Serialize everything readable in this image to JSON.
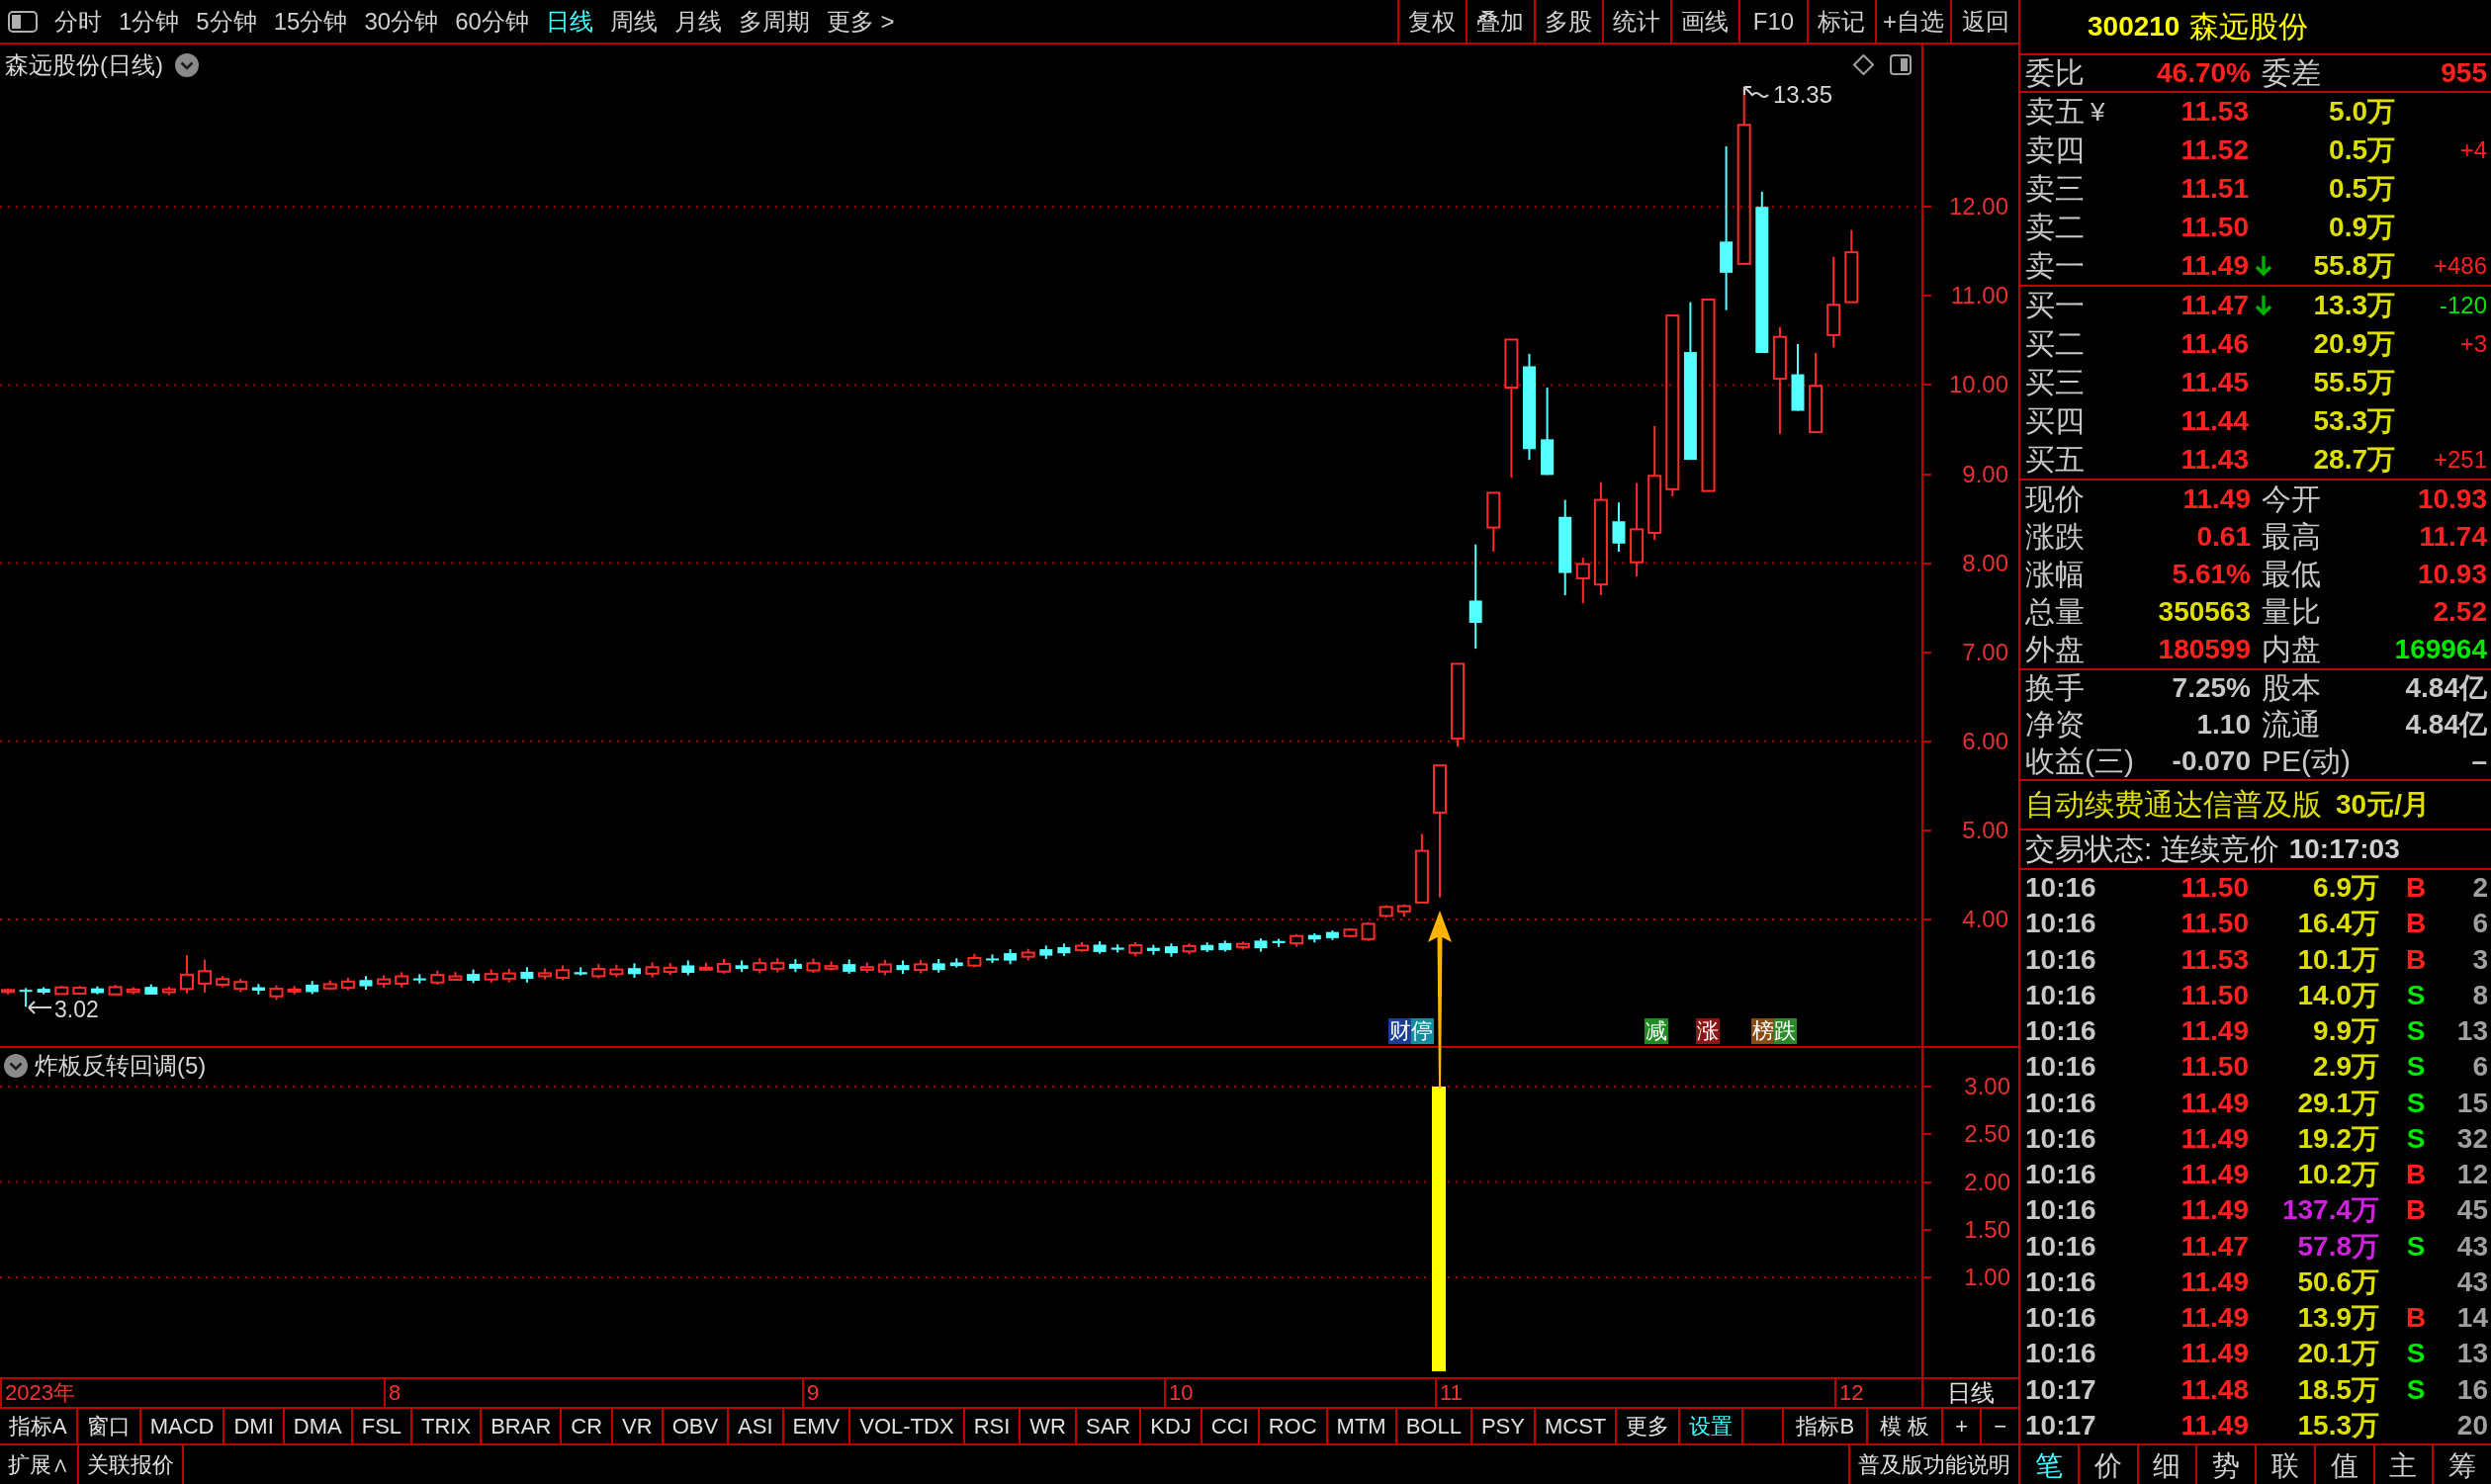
{
  "toolbar": {
    "periods": [
      {
        "label": "分时",
        "selected": false
      },
      {
        "label": "1分钟",
        "selected": false
      },
      {
        "label": "5分钟",
        "selected": false
      },
      {
        "label": "15分钟",
        "selected": false
      },
      {
        "label": "30分钟",
        "selected": false
      },
      {
        "label": "60分钟",
        "selected": false
      },
      {
        "label": "日线",
        "selected": true
      },
      {
        "label": "周线",
        "selected": false
      },
      {
        "label": "月线",
        "selected": false
      },
      {
        "label": "多周期",
        "selected": false
      },
      {
        "label": "更多 >",
        "selected": false
      }
    ],
    "actions": [
      "复权",
      "叠加",
      "多股",
      "统计",
      "画线",
      "F10",
      "标记",
      "+自选",
      "返回"
    ]
  },
  "chart": {
    "title": "森远股份(日线)",
    "price_ticks": [
      "12.00",
      "11.00",
      "10.00",
      "9.00",
      "8.00",
      "7.00",
      "6.00",
      "5.00",
      "4.00"
    ],
    "high_label": "13.35",
    "low_label": "3.02",
    "signals": [
      {
        "text": "财停",
        "kind": "finance"
      },
      {
        "text": "减",
        "kind": "reduce"
      },
      {
        "text": "涨",
        "kind": "rise"
      },
      {
        "text": "榜跌",
        "kind": "ranking"
      }
    ]
  },
  "indicator": {
    "title": "炸板反转回调(5)",
    "ticks": [
      "3.00",
      "2.50",
      "2.00",
      "1.50",
      "1.00"
    ]
  },
  "date_axis": {
    "months": [
      "2023年",
      "8",
      "9",
      "10",
      "11",
      "12"
    ],
    "period": "日线"
  },
  "indicator_tabs": [
    {
      "label": "指标A",
      "highlighted": false
    },
    {
      "label": "窗口",
      "highlighted": false
    },
    {
      "label": "MACD",
      "highlighted": false
    },
    {
      "label": "DMI",
      "highlighted": false
    },
    {
      "label": "DMA",
      "highlighted": false
    },
    {
      "label": "FSL",
      "highlighted": false
    },
    {
      "label": "TRIX",
      "highlighted": false
    },
    {
      "label": "BRAR",
      "highlighted": false
    },
    {
      "label": "CR",
      "highlighted": false
    },
    {
      "label": "VR",
      "highlighted": false
    },
    {
      "label": "OBV",
      "highlighted": false
    },
    {
      "label": "ASI",
      "highlighted": false
    },
    {
      "label": "EMV",
      "highlighted": false
    },
    {
      "label": "VOL-TDX",
      "highlighted": false
    },
    {
      "label": "RSI",
      "highlighted": false
    },
    {
      "label": "WR",
      "highlighted": false
    },
    {
      "label": "SAR",
      "highlighted": false
    },
    {
      "label": "KDJ",
      "highlighted": false
    },
    {
      "label": "CCI",
      "highlighted": false
    },
    {
      "label": "ROC",
      "highlighted": false
    },
    {
      "label": "MTM",
      "highlighted": false
    },
    {
      "label": "BOLL",
      "highlighted": false
    },
    {
      "label": "PSY",
      "highlighted": false
    },
    {
      "label": "MCST",
      "highlighted": false
    },
    {
      "label": "更多",
      "highlighted": false
    },
    {
      "label": "设置",
      "highlighted": true
    }
  ],
  "indicator_tools": [
    "指标B",
    "模 板",
    "+",
    "−"
  ],
  "bottom_bar": {
    "items": [
      "扩展∧",
      "关联报价"
    ],
    "help": "普及版功能说明"
  },
  "quote": {
    "code": "300210",
    "name": "森远股份",
    "ratio": [
      {
        "label": "委比",
        "value": "46.70%",
        "color": "#ff2020"
      },
      {
        "label": "委差",
        "value": "955",
        "color": "#ff2020"
      }
    ],
    "asks": [
      {
        "label": "卖五",
        "symbol": "¥",
        "price": "11.53",
        "price_falling": false,
        "volume": "5.0万"
      },
      {
        "label": "卖四",
        "price": "11.52",
        "price_falling": false,
        "volume": "0.5万",
        "change": {
          "text": "+4",
          "color": "#ff2020"
        }
      },
      {
        "label": "卖三",
        "price": "11.51",
        "price_falling": false,
        "volume": "0.5万"
      },
      {
        "label": "卖二",
        "price": "11.50",
        "price_falling": false,
        "volume": "0.9万"
      },
      {
        "label": "卖一",
        "price": "11.49",
        "price_falling": true,
        "volume": "55.8万",
        "change": {
          "text": "+486",
          "color": "#ff2020"
        }
      }
    ],
    "bids": [
      {
        "label": "买一",
        "price": "11.47",
        "price_falling": true,
        "volume": "13.3万",
        "change": {
          "text": "-120",
          "color": "#00e800"
        }
      },
      {
        "label": "买二",
        "price": "11.46",
        "price_falling": false,
        "volume": "20.9万",
        "change": {
          "text": "+3",
          "color": "#ff2020"
        }
      },
      {
        "label": "买三",
        "price": "11.45",
        "price_falling": false,
        "volume": "55.5万"
      },
      {
        "label": "买四",
        "price": "11.44",
        "price_falling": false,
        "volume": "53.3万"
      },
      {
        "label": "买五",
        "price": "11.43",
        "price_falling": false,
        "volume": "28.7万",
        "change": {
          "text": "+251",
          "color": "#ff2020"
        }
      }
    ],
    "stats": [
      {
        "label": "现价",
        "value": "11.49",
        "color": "#ff2020"
      },
      {
        "label": "今开",
        "value": "10.93",
        "color": "#ff2020"
      },
      {
        "label": "涨跌",
        "value": "0.61",
        "color": "#ff2020"
      },
      {
        "label": "最高",
        "value": "11.74",
        "color": "#ff2020"
      },
      {
        "label": "涨幅",
        "value": "5.61%",
        "color": "#ff2020"
      },
      {
        "label": "最低",
        "value": "10.93",
        "color": "#ff2020"
      },
      {
        "label": "总量",
        "value": "350563",
        "color": "#dede00"
      },
      {
        "label": "量比",
        "value": "2.52",
        "color": "#ff2020"
      },
      {
        "label": "外盘",
        "value": "180599",
        "color": "#ff2020"
      },
      {
        "label": "内盘",
        "value": "169964",
        "color": "#00e800"
      }
    ],
    "fundamentals": [
      {
        "label": "换手",
        "value": "7.25%"
      },
      {
        "label": "股本",
        "value": "4.84亿"
      },
      {
        "label": "净资",
        "value": "1.10"
      },
      {
        "label": "流通",
        "value": "4.84亿"
      },
      {
        "label": "收益(三)",
        "value": "-0.070"
      },
      {
        "label": "PE(动)",
        "value": "–"
      }
    ],
    "promo": {
      "text": "自动续费通达信普及版",
      "price": "30元/月"
    },
    "status": {
      "text": "交易状态: 连续竞价",
      "time": "10:17:03"
    }
  },
  "trades": [
    {
      "time": "10:16",
      "price": "11.50",
      "volume": "6.9万",
      "large": false,
      "side": {
        "text": "B",
        "color": "#ff2020"
      },
      "count": "2"
    },
    {
      "time": "10:16",
      "price": "11.50",
      "volume": "16.4万",
      "large": false,
      "side": {
        "text": "B",
        "color": "#ff2020"
      },
      "count": "6"
    },
    {
      "time": "10:16",
      "price": "11.53",
      "volume": "10.1万",
      "large": false,
      "side": {
        "text": "B",
        "color": "#ff2020"
      },
      "count": "3"
    },
    {
      "time": "10:16",
      "price": "11.50",
      "volume": "14.0万",
      "large": false,
      "side": {
        "text": "S",
        "color": "#00e800"
      },
      "count": "8"
    },
    {
      "time": "10:16",
      "price": "11.49",
      "volume": "9.9万",
      "large": false,
      "side": {
        "text": "S",
        "color": "#00e800"
      },
      "count": "13"
    },
    {
      "time": "10:16",
      "price": "11.50",
      "volume": "2.9万",
      "large": false,
      "side": {
        "text": "S",
        "color": "#00e800"
      },
      "count": "6"
    },
    {
      "time": "10:16",
      "price": "11.49",
      "volume": "29.1万",
      "large": false,
      "side": {
        "text": "S",
        "color": "#00e800"
      },
      "count": "15"
    },
    {
      "time": "10:16",
      "price": "11.49",
      "volume": "19.2万",
      "large": false,
      "side": {
        "text": "S",
        "color": "#00e800"
      },
      "count": "32"
    },
    {
      "time": "10:16",
      "price": "11.49",
      "volume": "10.2万",
      "large": false,
      "side": {
        "text": "B",
        "color": "#ff2020"
      },
      "count": "12"
    },
    {
      "time": "10:16",
      "price": "11.49",
      "volume": "137.4万",
      "large": true,
      "side": {
        "text": "B",
        "color": "#ff2020"
      },
      "count": "45"
    },
    {
      "time": "10:16",
      "price": "11.47",
      "volume": "57.8万",
      "large": true,
      "side": {
        "text": "S",
        "color": "#00e800"
      },
      "count": "43"
    },
    {
      "time": "10:16",
      "price": "11.49",
      "volume": "50.6万",
      "large": false,
      "count": "43"
    },
    {
      "time": "10:16",
      "price": "11.49",
      "volume": "13.9万",
      "large": false,
      "side": {
        "text": "B",
        "color": "#ff2020"
      },
      "count": "14"
    },
    {
      "time": "10:16",
      "price": "11.49",
      "volume": "20.1万",
      "large": false,
      "side": {
        "text": "S",
        "color": "#00e800"
      },
      "count": "13"
    },
    {
      "time": "10:17",
      "price": "11.48",
      "volume": "18.5万",
      "large": false,
      "side": {
        "text": "S",
        "color": "#00e800"
      },
      "count": "16"
    },
    {
      "time": "10:17",
      "price": "11.49",
      "volume": "15.3万",
      "large": false,
      "count": "20"
    }
  ],
  "panel_tabs": [
    {
      "label": "笔",
      "selected": true
    },
    {
      "label": "价",
      "selected": false
    },
    {
      "label": "细",
      "selected": false
    },
    {
      "label": "势",
      "selected": false
    },
    {
      "label": "联",
      "selected": false
    },
    {
      "label": "值",
      "selected": false
    },
    {
      "label": "主",
      "selected": false
    },
    {
      "label": "筹",
      "selected": false
    }
  ]
}
